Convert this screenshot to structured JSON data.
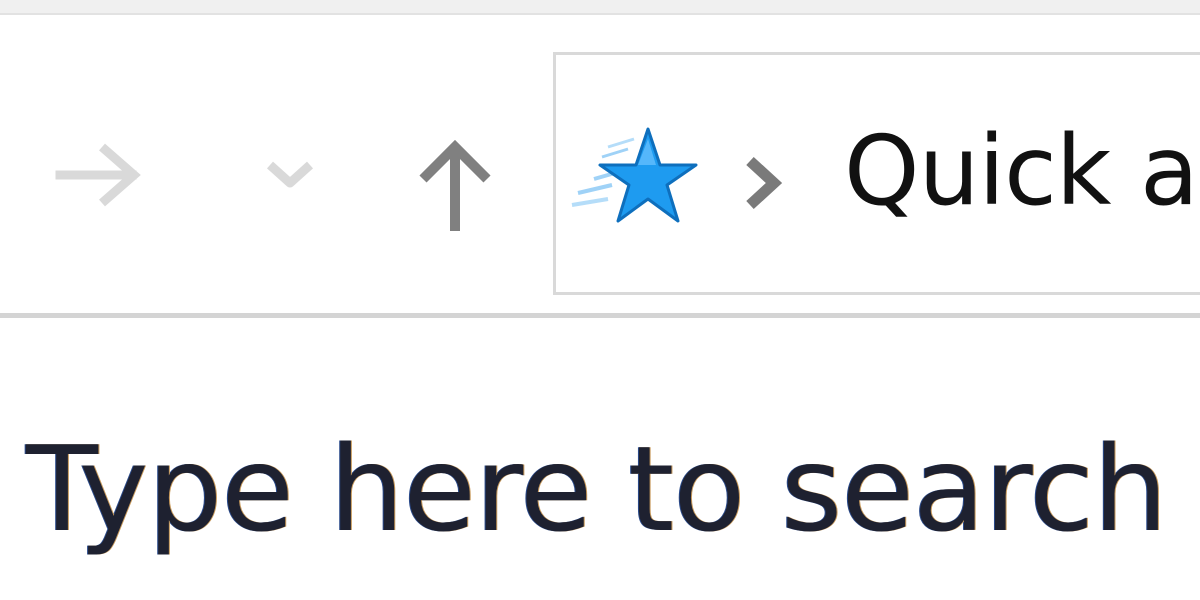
{
  "nav": {
    "forward": {
      "icon": "forward-arrow-icon",
      "enabled": false,
      "color": "#d9d9d9"
    },
    "recent_locations": {
      "icon": "chevron-down-icon",
      "enabled": false,
      "color": "#d9d9d9"
    },
    "up": {
      "icon": "up-arrow-icon",
      "enabled": true,
      "color": "#808080"
    }
  },
  "address_bar": {
    "location_icon": "quick-access-star-icon",
    "separator_icon": "chevron-right-icon",
    "path_text": "Quick ac",
    "star_color": "#1e9bf0"
  },
  "search": {
    "placeholder": "Type here to search"
  }
}
